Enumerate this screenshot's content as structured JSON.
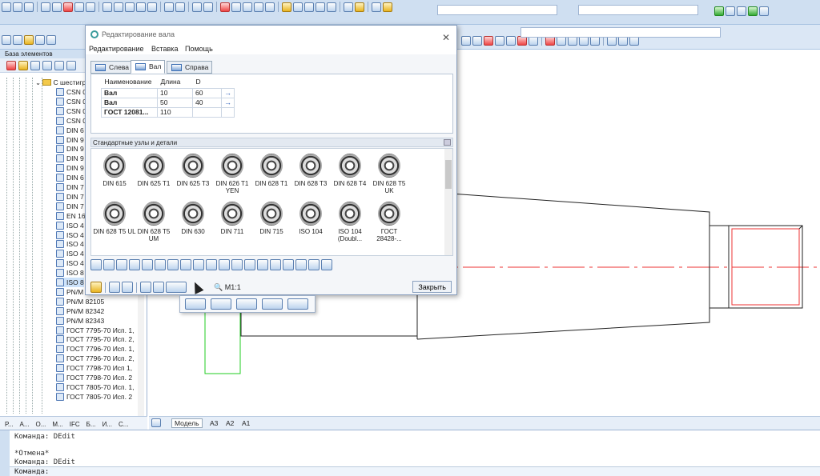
{
  "left_panel": {
    "title": "База элементов",
    "folder_label": "С шестигр",
    "items": [
      "CSN 0",
      "CSN 0",
      "CSN 0",
      "CSN 0",
      "DIN 6",
      "DIN 9",
      "DIN 9",
      "DIN 9",
      "DIN 9",
      "DIN 6",
      "DIN 7",
      "DIN 7",
      "DIN 7",
      "EN 16",
      "ISO 4",
      "ISO 4",
      "ISO 4",
      "ISO 4",
      "ISO 4",
      "ISO 8",
      "ISO 8",
      "PN/M 82101",
      "PN/M 82105",
      "PN/M 82342",
      "PN/M 82343",
      "ГОСТ 7795-70 Исп. 1,",
      "ГОСТ 7795-70 Исп. 2,",
      "ГОСТ 7796-70 Исп. 1,",
      "ГОСТ 7796-70 Исп. 2,",
      "ГОСТ 7798-70 Исп 1,",
      "ГОСТ 7798-70 Исп. 2",
      "ГОСТ 7805-70 Исп. 1,",
      "ГОСТ 7805-70 Исп. 2"
    ],
    "bottom_tabs": [
      "Р...",
      "А...",
      "О...",
      "М...",
      "IFC",
      "Б...",
      "И...",
      "С..."
    ]
  },
  "dialog": {
    "title": "Редактирование вала",
    "menu": [
      "Редактирование",
      "Вставка",
      "Помощь"
    ],
    "tabs": [
      "Слева",
      "Вал",
      "Справа"
    ],
    "table": {
      "headers": [
        "Наименование",
        "Длина",
        "D"
      ],
      "rows": [
        {
          "name": "Вал",
          "length": "10",
          "d": "60"
        },
        {
          "name": "Вал",
          "length": "50",
          "d": "40"
        },
        {
          "name": "ГОСТ 12081...",
          "length": "110",
          "d": ""
        }
      ]
    },
    "section_title": "Стандартные узлы и детали",
    "catalog": [
      "DIN 615",
      "DIN 625 T1",
      "DIN 625 T3",
      "DIN 626 T1 YEN",
      "DIN 628 T1",
      "DIN 628 T3",
      "DIN 628 T4",
      "DIN 628 T5 UK",
      "DIN 628 T5 UL",
      "DIN 628 T5 UM",
      "DIN 630",
      "DIN 711",
      "DIN 715",
      "ISO 104",
      "ISO 104 (Doubl...",
      "ГОСТ 28428-..."
    ],
    "zoom_label": "М1:1",
    "close_button": "Закрыть"
  },
  "model_tabs": [
    "Модель",
    "A3",
    "A2",
    "A1"
  ],
  "command_lines": [
    "Команда: DEdit",
    "",
    "*Отмена*",
    "Команда: DEdit",
    "Команда:"
  ]
}
